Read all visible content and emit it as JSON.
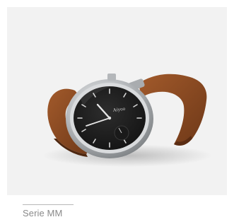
{
  "product": {
    "caption": "Serie MM",
    "dial_brand": "Aiyoo"
  },
  "photo": {
    "subject": "wristwatch-icon",
    "colors": {
      "background": "#f2f2f2",
      "strap": "#8a4a22",
      "dial": "#1c1c1c",
      "case": "#c7c9cb"
    }
  }
}
